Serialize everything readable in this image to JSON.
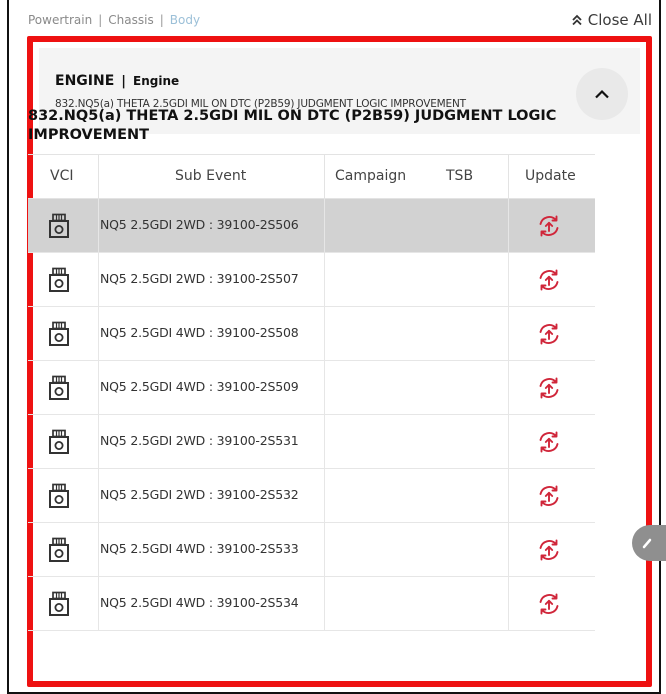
{
  "categories": [
    {
      "label": "Powertrain"
    },
    {
      "label": "Chassis"
    },
    {
      "label": "Body"
    }
  ],
  "separator": "|",
  "close_all_label": "Close All",
  "section": {
    "title": "ENGINE",
    "subtitle": "Engine",
    "description": "832.NQ5(a) THETA 2.5GDI MIL ON DTC (P2B59) JUDGMENT LOGIC IMPROVEMENT"
  },
  "event_title": "832.NQ5(a) THETA 2.5GDI MIL ON DTC (P2B59) JUDGMENT LOGIC IMPROVEMENT",
  "table": {
    "headers": {
      "vci": "VCI",
      "sub_event": "Sub Event",
      "campaign": "Campaign",
      "tsb": "TSB",
      "update": "Update"
    },
    "rows": [
      {
        "sub_event": "NQ5 2.5GDI 2WD : 39100-2S506",
        "selected": true
      },
      {
        "sub_event": "NQ5 2.5GDI 2WD : 39100-2S507",
        "selected": false
      },
      {
        "sub_event": "NQ5 2.5GDI 4WD : 39100-2S508",
        "selected": false
      },
      {
        "sub_event": "NQ5 2.5GDI 4WD : 39100-2S509",
        "selected": false
      },
      {
        "sub_event": "NQ5 2.5GDI 2WD : 39100-2S531",
        "selected": false
      },
      {
        "sub_event": "NQ5 2.5GDI 2WD : 39100-2S532",
        "selected": false
      },
      {
        "sub_event": "NQ5 2.5GDI 4WD : 39100-2S533",
        "selected": false
      },
      {
        "sub_event": "NQ5 2.5GDI 4WD : 39100-2S534",
        "selected": false
      }
    ]
  },
  "icons": {
    "vci": "vci-device-icon",
    "update": "update-sync-icon",
    "toggle": "chevron-up-icon",
    "close_all": "double-chevron-up-icon"
  },
  "colors": {
    "highlight_red": "#ee1111",
    "update_icon": "#d0263a",
    "selected_row": "#d2d2d2"
  }
}
